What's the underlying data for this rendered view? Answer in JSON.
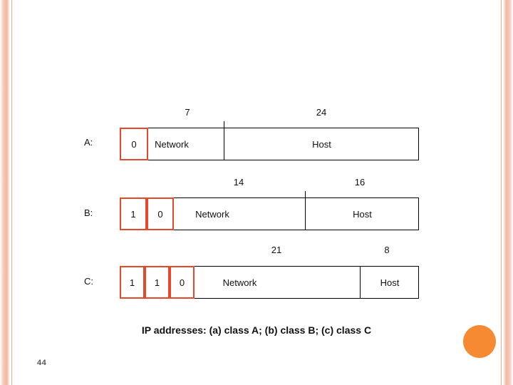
{
  "slide": {
    "number": "44",
    "caption": "IP addresses: (a) class A; (b) class B; (c) class C"
  },
  "diagram": {
    "rows": [
      {
        "label": "A:",
        "leading_bits": [
          "0"
        ],
        "fields": [
          {
            "name": "Network",
            "bits": "7"
          },
          {
            "name": "Host",
            "bits": "24"
          }
        ]
      },
      {
        "label": "B:",
        "leading_bits": [
          "1",
          "0"
        ],
        "fields": [
          {
            "name": "Network",
            "bits": "14"
          },
          {
            "name": "Host",
            "bits": "16"
          }
        ]
      },
      {
        "label": "C:",
        "leading_bits": [
          "1",
          "1",
          "0"
        ],
        "fields": [
          {
            "name": "Network",
            "bits": "21"
          },
          {
            "name": "Host",
            "bits": "8"
          }
        ]
      }
    ]
  },
  "colors": {
    "bit_box_border": "#e8482a",
    "accent_dot": "#f68a33",
    "frame": "#f3b9a3"
  }
}
